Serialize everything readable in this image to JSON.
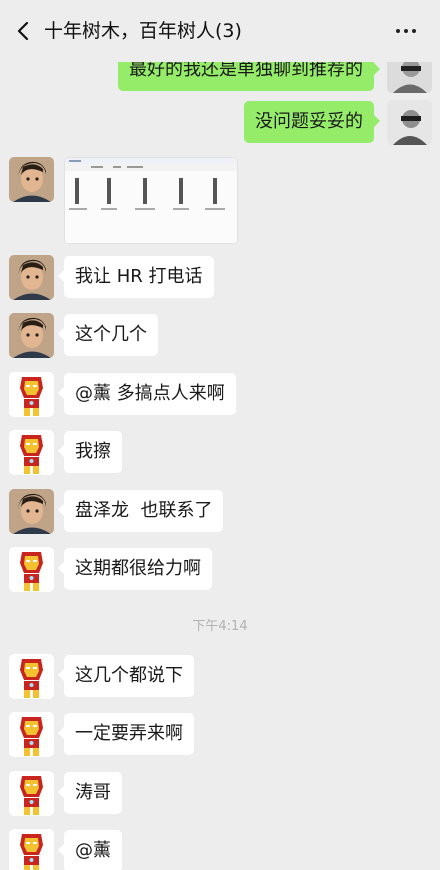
{
  "header": {
    "title": "十年树木，百年树人(3)",
    "back_icon": "chevron-left-icon",
    "more_icon": "more-dots-icon"
  },
  "messages": [
    {
      "direction": "out",
      "text": "最好的我还是单独聊到推荐的"
    },
    {
      "direction": "out",
      "text": "没问题妥妥的"
    },
    {
      "direction": "in",
      "type": "image",
      "image_content": "file-folder-screenshot"
    },
    {
      "direction": "in",
      "text": "我让 HR 打电话"
    },
    {
      "direction": "in",
      "text": "这个几个"
    },
    {
      "direction": "in",
      "text": "@薰 多搞点人来啊"
    },
    {
      "direction": "in",
      "text": "我擦"
    },
    {
      "direction": "in",
      "text": "盘泽龙  也联系了"
    },
    {
      "direction": "in",
      "text": "这期都很给力啊"
    },
    {
      "type": "timestamp",
      "text": "下午4:14"
    },
    {
      "direction": "in",
      "text": "这几个都说下"
    },
    {
      "direction": "in",
      "text": "一定要弄来啊"
    },
    {
      "direction": "in",
      "text": "涛哥"
    },
    {
      "direction": "in",
      "text": "@薰"
    }
  ],
  "colors": {
    "background": "#ededed",
    "incoming_bubble": "#ffffff",
    "outgoing_bubble": "#95ec69",
    "timestamp_text": "#b2b2b2"
  }
}
